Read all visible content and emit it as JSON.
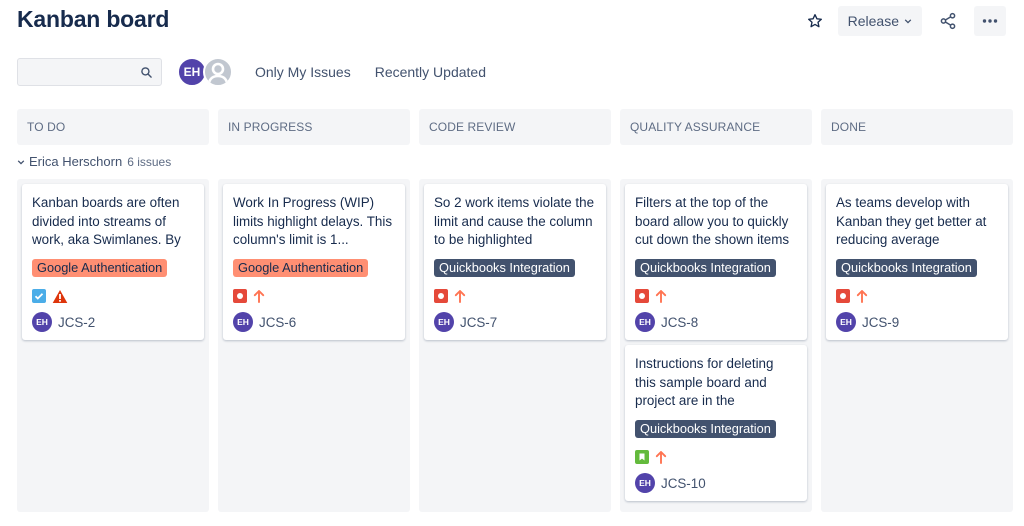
{
  "header": {
    "title": "Kanban board",
    "release_label": "Release",
    "icons": {
      "star": "star-icon",
      "release_chevron": "chevron-down-icon",
      "share": "share-icon",
      "more": "more-icon"
    }
  },
  "toolbar": {
    "search": {
      "value": "",
      "placeholder": "",
      "icon": "search-icon"
    },
    "avatars": [
      {
        "initials": "EH",
        "color": "#5243aa"
      },
      {
        "initials": "",
        "type": "unassigned"
      }
    ],
    "filters": [
      "Only My Issues",
      "Recently Updated"
    ]
  },
  "columns": [
    {
      "title": "TO DO"
    },
    {
      "title": "IN PROGRESS"
    },
    {
      "title": "CODE REVIEW"
    },
    {
      "title": "QUALITY ASSURANCE"
    },
    {
      "title": "DONE"
    }
  ],
  "swimlane": {
    "name": "Erica Herschorn",
    "count_label": "6 issues"
  },
  "cards": [
    {
      "column": 0,
      "summary": "Kanban boards are often divided into streams of work, aka Swimlanes. By",
      "epic": "Google Authentication",
      "epic_color": "#ff8f73",
      "issue_type": "task",
      "priority": "highest",
      "assignee": "EH",
      "key": "JCS-2"
    },
    {
      "column": 1,
      "summary": "Work In Progress (WIP) limits highlight delays. This column's limit is 1...",
      "epic": "Google Authentication",
      "epic_color": "#ff8f73",
      "issue_type": "bug",
      "priority": "high",
      "assignee": "EH",
      "key": "JCS-6"
    },
    {
      "column": 2,
      "summary": "So 2 work items violate the limit and cause the column to be highlighted",
      "epic": "Quickbooks Integration",
      "epic_color": "#42526e",
      "issue_type": "bug",
      "priority": "high",
      "assignee": "EH",
      "key": "JCS-7"
    },
    {
      "column": 3,
      "summary": "Filters at the top of the board allow you to quickly cut down the shown items",
      "epic": "Quickbooks Integration",
      "epic_color": "#42526e",
      "issue_type": "bug",
      "priority": "high",
      "assignee": "EH",
      "key": "JCS-8"
    },
    {
      "column": 3,
      "summary": "Instructions for deleting this sample board and project are in the",
      "epic": "Quickbooks Integration",
      "epic_color": "#42526e",
      "issue_type": "story",
      "priority": "high",
      "assignee": "EH",
      "key": "JCS-10"
    },
    {
      "column": 4,
      "summary": "As teams develop with Kanban they get better at reducing average resolution",
      "epic": "Quickbooks Integration",
      "epic_color": "#42526e",
      "issue_type": "bug",
      "priority": "high",
      "assignee": "EH",
      "key": "JCS-9"
    }
  ],
  "colors": {
    "title": "#172b4d",
    "column_bg": "#f4f5f7",
    "avatar": "#5243aa",
    "bug": "#e5493a",
    "task": "#4bade8",
    "story": "#63ba3c",
    "priority_high": "#ff7452",
    "priority_highest": "#de350b"
  }
}
